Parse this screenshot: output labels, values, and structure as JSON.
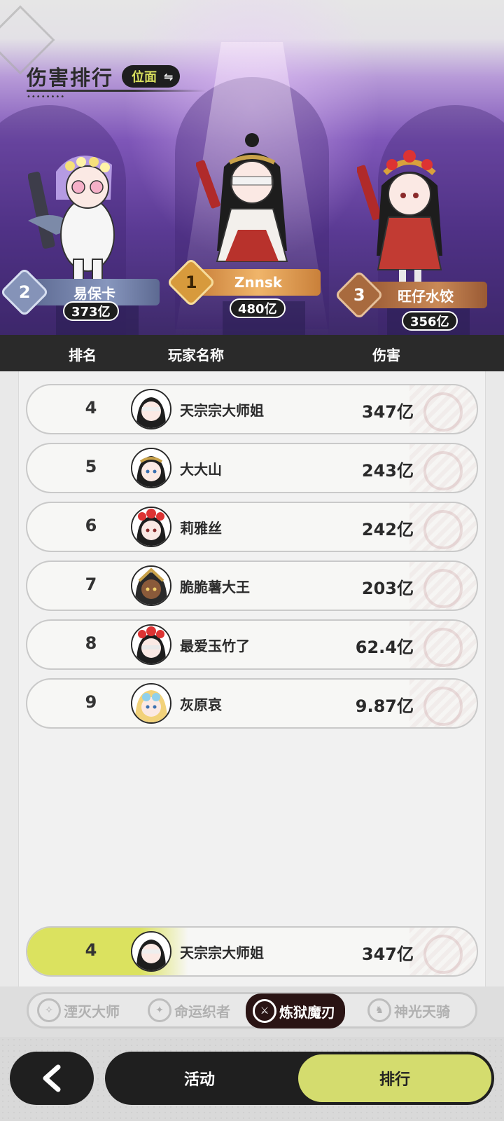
{
  "header": {
    "title": "伤害排行",
    "scope_label": "位面",
    "swap_icon": "swap-arrows-icon"
  },
  "podium": {
    "first": {
      "rank": "1",
      "name": "Znnsk",
      "damage": "480亿"
    },
    "second": {
      "rank": "2",
      "name": "易保卡",
      "damage": "373亿"
    },
    "third": {
      "rank": "3",
      "name": "旺仔水饺",
      "damage": "356亿"
    }
  },
  "table": {
    "headers": {
      "rank": "排名",
      "player": "玩家名称",
      "damage": "伤害"
    },
    "rows": [
      {
        "rank": "4",
        "name": "天宗宗大师姐",
        "damage": "347亿"
      },
      {
        "rank": "5",
        "name": "大大山",
        "damage": "243亿"
      },
      {
        "rank": "6",
        "name": "莉雅丝",
        "damage": "242亿"
      },
      {
        "rank": "7",
        "name": "脆脆薯大王",
        "damage": "203亿"
      },
      {
        "rank": "8",
        "name": "最爱玉竹了",
        "damage": "62.4亿"
      },
      {
        "rank": "9",
        "name": "灰原哀",
        "damage": "9.87亿"
      }
    ],
    "my_row": {
      "rank": "4",
      "name": "天宗宗大师姐",
      "damage": "347亿"
    }
  },
  "class_tabs": [
    {
      "label": "湮灭大师",
      "icon": "annihilation-emblem-icon",
      "active": false
    },
    {
      "label": "命运织者",
      "icon": "fate-emblem-icon",
      "active": false
    },
    {
      "label": "炼狱魔刃",
      "icon": "inferno-blade-emblem-icon",
      "active": true
    },
    {
      "label": "神光天骑",
      "icon": "holy-knight-emblem-icon",
      "active": false
    }
  ],
  "bottom_nav": {
    "back_icon": "chevron-left-icon",
    "activity_label": "活动",
    "rank_label": "排行"
  },
  "colors": {
    "accent": "#d4dc6e",
    "dark": "#1f1f1f",
    "gold_plate": "#e7a85a",
    "silver_plate": "#6f7ea8",
    "bronze_plate": "#b5744a"
  }
}
